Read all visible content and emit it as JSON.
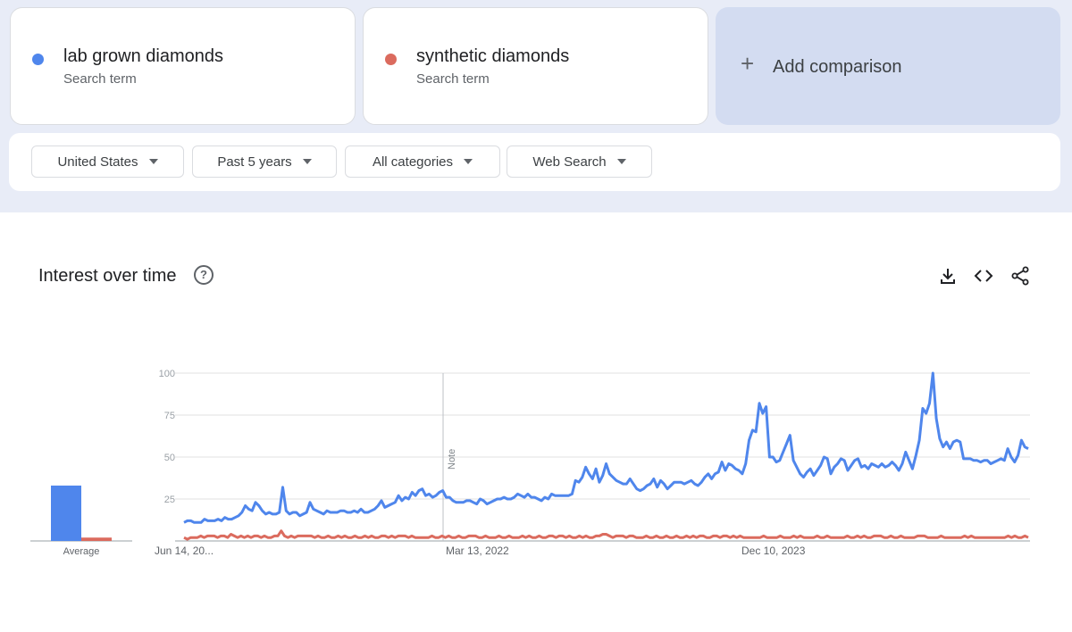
{
  "terms": [
    {
      "name": "lab grown diamonds",
      "sub": "Search term",
      "color": "#4f86ec"
    },
    {
      "name": "synthetic diamonds",
      "sub": "Search term",
      "color": "#db6b5e"
    }
  ],
  "add_comparison": {
    "icon": "+",
    "label": "Add comparison"
  },
  "filters": [
    {
      "label": "United States"
    },
    {
      "label": "Past 5 years"
    },
    {
      "label": "All categories"
    },
    {
      "label": "Web Search"
    }
  ],
  "chart_panel": {
    "title": "Interest over time",
    "help_icon": "?",
    "tools": [
      "download-icon",
      "embed-icon",
      "share-icon"
    ]
  },
  "chart_data": {
    "type": "line",
    "ylim": [
      0,
      100
    ],
    "yticks": [
      25,
      50,
      75,
      100
    ],
    "x_tick_labels": [
      "Jun 14, 20...",
      "Mar 13, 2022",
      "Dec 10, 2023"
    ],
    "note_label": "Note",
    "average_label": "Average",
    "averages": [
      33,
      2
    ],
    "series": [
      {
        "name": "lab grown diamonds",
        "color": "#4f86ec",
        "values": [
          11,
          12,
          12,
          11,
          11,
          11,
          13,
          12,
          12,
          12,
          13,
          12,
          14,
          13,
          13,
          14,
          15,
          17,
          21,
          19,
          18,
          23,
          21,
          18,
          16,
          17,
          16,
          16,
          17,
          32,
          18,
          16,
          17,
          17,
          15,
          16,
          17,
          23,
          19,
          18,
          17,
          16,
          18,
          17,
          17,
          17,
          18,
          18,
          17,
          17,
          18,
          17,
          19,
          17,
          17,
          18,
          19,
          21,
          24,
          20,
          21,
          22,
          23,
          27,
          24,
          26,
          25,
          29,
          27,
          30,
          31,
          27,
          28,
          26,
          27,
          29,
          30,
          26,
          26,
          24,
          23,
          23,
          23,
          24,
          24,
          23,
          22,
          25,
          24,
          22,
          23,
          24,
          25,
          25,
          26,
          25,
          25,
          26,
          28,
          27,
          26,
          28,
          26,
          26,
          25,
          24,
          26,
          25,
          28,
          27,
          27,
          27,
          27,
          27,
          28,
          36,
          35,
          38,
          44,
          40,
          37,
          43,
          35,
          39,
          46,
          40,
          38,
          36,
          35,
          34,
          34,
          37,
          34,
          31,
          30,
          31,
          33,
          34,
          37,
          32,
          36,
          34,
          31,
          33,
          35,
          35,
          35,
          34,
          35,
          36,
          34,
          33,
          35,
          38,
          40,
          37,
          40,
          41,
          47,
          42,
          46,
          45,
          43,
          42,
          40,
          46,
          60,
          66,
          65,
          82,
          76,
          80,
          50,
          50,
          47,
          48,
          53,
          58,
          63,
          48,
          44,
          40,
          38,
          41,
          43,
          39,
          42,
          45,
          50,
          49,
          40,
          44,
          46,
          49,
          48,
          42,
          45,
          48,
          49,
          44,
          45,
          43,
          46,
          45,
          44,
          46,
          44,
          45,
          47,
          45,
          42,
          46,
          53,
          48,
          43,
          51,
          60,
          79,
          76,
          82,
          100,
          73,
          61,
          56,
          59,
          55,
          59,
          60,
          59,
          49,
          49,
          49,
          48,
          48,
          47,
          48,
          48,
          46,
          47,
          48,
          49,
          48,
          55,
          50,
          47,
          51,
          60,
          56,
          55
        ],
        "x_start": 0.0,
        "x_end": 1.0
      },
      {
        "name": "synthetic diamonds",
        "color": "#db6b5e",
        "values": [
          2,
          1,
          2,
          2,
          2,
          3,
          2,
          3,
          3,
          3,
          2,
          3,
          3,
          2,
          4,
          3,
          2,
          3,
          2,
          3,
          2,
          3,
          3,
          2,
          3,
          2,
          2,
          3,
          3,
          6,
          3,
          2,
          3,
          2,
          3,
          3,
          3,
          3,
          3,
          2,
          3,
          2,
          2,
          3,
          2,
          2,
          3,
          2,
          3,
          2,
          2,
          3,
          2,
          2,
          3,
          2,
          3,
          2,
          2,
          3,
          3,
          2,
          3,
          2,
          3,
          3,
          3,
          2,
          3,
          2,
          2,
          2,
          2,
          2,
          3,
          2,
          2,
          3,
          2,
          3,
          2,
          2,
          3,
          2,
          2,
          3,
          3,
          3,
          2,
          2,
          3,
          2,
          2,
          2,
          3,
          2,
          2,
          3,
          2,
          2,
          2,
          3,
          2,
          3,
          2,
          2,
          3,
          2,
          2,
          3,
          3,
          2,
          3,
          3,
          2,
          3,
          2,
          2,
          3,
          2,
          3,
          2,
          2,
          3,
          3,
          4,
          4,
          3,
          2,
          3,
          3,
          3,
          2,
          3,
          3,
          2,
          2,
          2,
          3,
          2,
          2,
          3,
          2,
          2,
          3,
          2,
          2,
          3,
          2,
          2,
          3,
          2,
          3,
          2,
          3,
          3,
          2,
          2,
          3,
          3,
          2,
          3,
          3,
          2,
          3,
          2,
          3,
          2,
          2,
          2,
          2,
          2,
          2,
          3,
          2,
          2,
          2,
          2,
          3,
          2,
          2,
          2,
          3,
          2,
          3,
          2,
          2,
          2,
          2,
          3,
          2,
          2,
          3,
          2,
          2,
          2,
          2,
          2,
          3,
          2,
          2,
          3,
          2,
          3,
          2,
          2,
          3,
          3,
          3,
          2,
          2,
          3,
          2,
          2,
          3,
          2,
          2,
          2,
          2,
          3,
          3,
          3,
          2,
          2,
          2,
          2,
          3,
          2,
          2,
          2,
          2,
          2,
          2,
          3,
          2,
          3,
          2,
          2,
          2,
          2,
          2,
          2,
          2,
          2,
          2,
          2,
          3,
          2,
          3,
          2,
          2,
          3,
          2
        ]
      }
    ]
  }
}
